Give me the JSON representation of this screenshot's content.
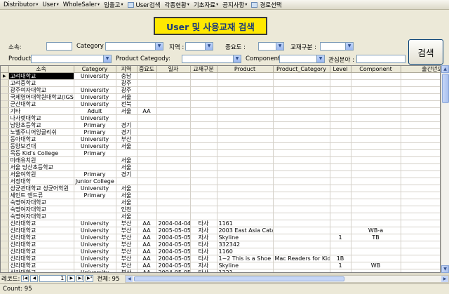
{
  "menu": [
    {
      "label": "Distributor",
      "arrow": true
    },
    {
      "label": "User",
      "arrow": true
    },
    {
      "label": "WholeSaler",
      "arrow": true
    },
    {
      "label": "입출고",
      "arrow": true
    },
    {
      "label": "User검색",
      "icon": true
    },
    {
      "label": "각종현황",
      "arrow": true
    },
    {
      "label": "기초자료",
      "arrow": true
    },
    {
      "label": "공지사항",
      "arrow": true
    },
    {
      "label": "경로선택",
      "icon": true
    }
  ],
  "title": "User 및 사용교재 검색",
  "filters": {
    "school_label": "소속:",
    "category_label": "Category :",
    "region_label": "지역 :",
    "importance_label": "중요도 :",
    "textbook_type_label": "교재구분 :",
    "product_label": "Product:",
    "product_category_label": "Product Categody:",
    "component_label": "Component:",
    "interest_label": "관심분야 :"
  },
  "search_button": "검색",
  "columns": [
    "소속",
    "Category",
    "지역",
    "중요도",
    "일자",
    "교재구분",
    "Product",
    "Product_Category",
    "Level",
    "Component",
    "출간년도"
  ],
  "rows": [
    [
      "고려대학교",
      "University",
      "충남",
      "",
      "",
      "",
      "",
      "",
      "",
      "",
      ""
    ],
    [
      "고려중학교",
      "",
      "광주",
      "",
      "",
      "",
      "",
      "",
      "",
      "",
      ""
    ],
    [
      "광주여자대학교",
      "University",
      "광주",
      "",
      "",
      "",
      "",
      "",
      "",
      "",
      ""
    ],
    [
      "국제영어대학원대학교(IGS",
      "University",
      "서울",
      "",
      "",
      "",
      "",
      "",
      "",
      "",
      ""
    ],
    [
      "군산대학교",
      "University",
      "전북",
      "",
      "",
      "",
      "",
      "",
      "",
      "",
      ""
    ],
    [
      "기타",
      "Adult",
      "서울",
      "AA",
      "",
      "",
      "",
      "",
      "",
      "",
      ""
    ],
    [
      "나사렛대학교",
      "University",
      "",
      "",
      "",
      "",
      "",
      "",
      "",
      "",
      ""
    ],
    [
      "남양초등학교",
      "Primary",
      "경기",
      "",
      "",
      "",
      "",
      "",
      "",
      "",
      ""
    ],
    [
      "노벨주니어잉글리쉬",
      "Primary",
      "경기",
      "",
      "",
      "",
      "",
      "",
      "",
      "",
      ""
    ],
    [
      "동아대학교",
      "University",
      "부산",
      "",
      "",
      "",
      "",
      "",
      "",
      "",
      ""
    ],
    [
      "동양보건대",
      "University",
      "서울",
      "",
      "",
      "",
      "",
      "",
      "",
      "",
      ""
    ],
    [
      "목동 Kid's College",
      "Primary",
      "",
      "",
      "",
      "",
      "",
      "",
      "",
      "",
      ""
    ],
    [
      "미래유치원",
      "",
      "서울",
      "",
      "",
      "",
      "",
      "",
      "",
      "",
      ""
    ],
    [
      "서울 당산초등학교",
      "",
      "서울",
      "",
      "",
      "",
      "",
      "",
      "",
      "",
      ""
    ],
    [
      "서울여학원",
      "Primary",
      "경기",
      "",
      "",
      "",
      "",
      "",
      "",
      "",
      ""
    ],
    [
      "서정대학",
      "Junior College",
      "",
      "",
      "",
      "",
      "",
      "",
      "",
      "",
      ""
    ],
    [
      "성균관대학교 성균어학원",
      "University",
      "서울",
      "",
      "",
      "",
      "",
      "",
      "",
      "",
      ""
    ],
    [
      "세인트 엔드류",
      "Primary",
      "서울",
      "",
      "",
      "",
      "",
      "",
      "",
      "",
      ""
    ],
    [
      "숙명여자대학교",
      "",
      "서울",
      "",
      "",
      "",
      "",
      "",
      "",
      "",
      ""
    ],
    [
      "숙명여자대학교",
      "",
      "인천",
      "",
      "",
      "",
      "",
      "",
      "",
      "",
      ""
    ],
    [
      "숙명여자대학교",
      "",
      "서울",
      "",
      "",
      "",
      "",
      "",
      "",
      "",
      ""
    ],
    [
      "신라대학교",
      "University",
      "부산",
      "AA",
      "2004-04-04",
      "타사",
      "1161",
      "",
      "",
      "",
      ""
    ],
    [
      "신라대학교",
      "University",
      "부산",
      "AA",
      "2005-05-05",
      "자사",
      "2003 East Asia Catalo",
      "",
      "",
      "WB-a",
      ""
    ],
    [
      "신라대학교",
      "University",
      "부산",
      "AA",
      "2004-05-05",
      "자사",
      "Skyline",
      "",
      "1",
      "TB",
      ""
    ],
    [
      "신라대학교",
      "University",
      "부산",
      "AA",
      "2004-05-05",
      "타사",
      "332342",
      "",
      "",
      "",
      ""
    ],
    [
      "신라대학교",
      "University",
      "부산",
      "AA",
      "2004-05-05",
      "타사",
      "1160",
      "",
      "",
      "",
      ""
    ],
    [
      "신라대학교",
      "University",
      "부산",
      "AA",
      "2004-05-05",
      "타사",
      "1~2 This is a Shoe",
      "Mac Readers for Kids",
      "1B",
      "",
      ""
    ],
    [
      "신라대학교",
      "University",
      "부산",
      "AA",
      "2004-05-05",
      "자사",
      "Skyline",
      "",
      "1",
      "WB",
      ""
    ],
    [
      "신라대학교",
      "University",
      "부산",
      "AA",
      "2004-05-05",
      "타사",
      "1221",
      "",
      "",
      "",
      ""
    ]
  ],
  "nav": {
    "label": "레코드:",
    "position": "1",
    "total": "전체: 95"
  },
  "status": "Count: 95"
}
